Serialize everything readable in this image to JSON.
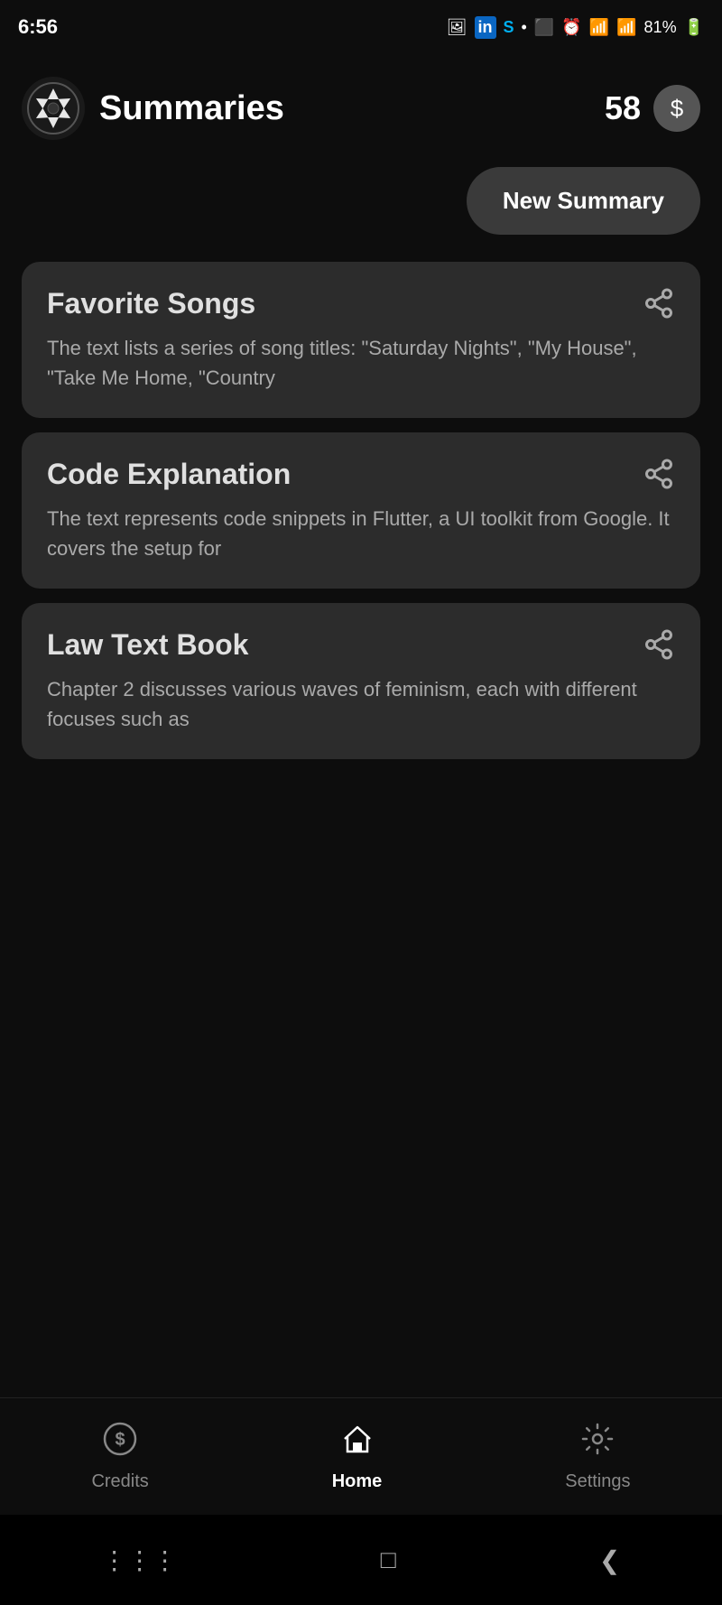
{
  "statusBar": {
    "time": "6:56",
    "battery": "81%",
    "icons": [
      "photo",
      "linkedin",
      "skype",
      "dot"
    ]
  },
  "header": {
    "appTitle": "Summaries",
    "creditsCount": "58",
    "logoAlt": "app-logo"
  },
  "newSummaryButton": {
    "label": "New Summary"
  },
  "summaries": [
    {
      "id": 1,
      "title": "Favorite Songs",
      "description": "The text lists a series of song titles: \"Saturday Nights\", \"My House\", \"Take Me Home, \"Country"
    },
    {
      "id": 2,
      "title": "Code Explanation",
      "description": "The text represents code snippets in Flutter, a UI toolkit from Google. It covers the setup for"
    },
    {
      "id": 3,
      "title": "Law Text Book",
      "description": "Chapter 2 discusses various waves of feminism, each with different focuses such as"
    }
  ],
  "bottomNav": {
    "items": [
      {
        "id": "credits",
        "label": "Credits",
        "active": false
      },
      {
        "id": "home",
        "label": "Home",
        "active": true
      },
      {
        "id": "settings",
        "label": "Settings",
        "active": false
      }
    ]
  },
  "systemNav": {
    "buttons": [
      "|||",
      "□",
      "<"
    ]
  }
}
